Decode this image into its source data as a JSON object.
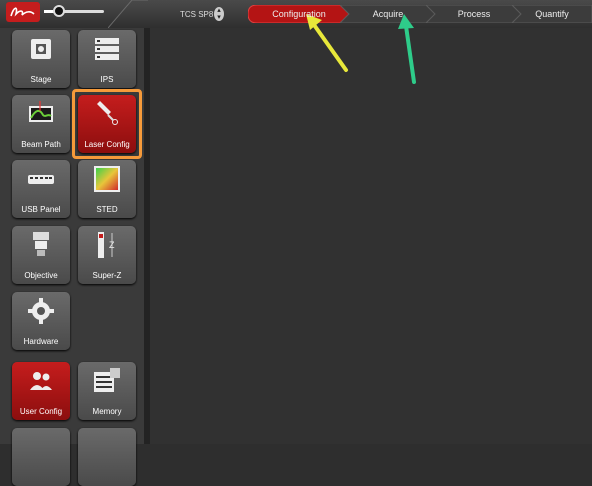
{
  "app": {
    "system_name": "TCS SP8"
  },
  "colors": {
    "accent_red": "#c51d1d",
    "highlight_orange": "#f59a3a",
    "arrow_yellow": "#e8e83a",
    "arrow_green": "#2ecc8a"
  },
  "workflow_steps": [
    {
      "label": "Configuration",
      "active": true
    },
    {
      "label": "Acquire",
      "active": false
    },
    {
      "label": "Process",
      "active": false
    },
    {
      "label": "Quantify",
      "active": false
    }
  ],
  "zoom_slider": {
    "level": 0.25
  },
  "tiles": [
    {
      "label": "Stage",
      "icon": "stage-icon"
    },
    {
      "label": "IPS",
      "icon": "ips-icon"
    },
    {
      "label": "Beam Path",
      "icon": "beam-path-icon"
    },
    {
      "label": "Laser Config",
      "icon": "laser-config-icon",
      "selected": true
    },
    {
      "label": "USB Panel",
      "icon": "usb-panel-icon"
    },
    {
      "label": "STED",
      "icon": "sted-icon"
    },
    {
      "label": "Objective",
      "icon": "objective-icon"
    },
    {
      "label": "Super-Z",
      "icon": "super-z-icon"
    },
    {
      "label": "Hardware",
      "icon": "gear-icon"
    },
    {
      "label": "User Config",
      "icon": "user-config-icon"
    },
    {
      "label": "Memory",
      "icon": "memory-icon"
    }
  ]
}
